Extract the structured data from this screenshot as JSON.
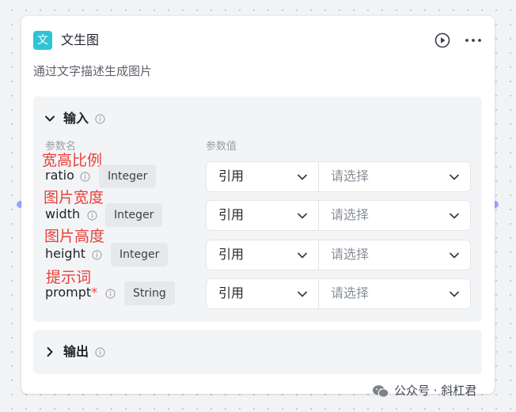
{
  "node": {
    "icon_text": "文",
    "title": "文生图",
    "description": "通过文字描述生成图片",
    "accent_color": "#2ec4d6",
    "run_icon": "play-circle-icon",
    "more_icon": "more-horizontal-icon"
  },
  "inputs": {
    "title": "输入",
    "col_name": "参数名",
    "col_value": "参数值",
    "params": [
      {
        "annotation": "宽高比例",
        "name": "ratio",
        "required": "",
        "type": "Integer",
        "source": "引用",
        "value_placeholder": "请选择"
      },
      {
        "annotation": "图片宽度",
        "name": "width",
        "required": "",
        "type": "Integer",
        "source": "引用",
        "value_placeholder": "请选择"
      },
      {
        "annotation": "图片高度",
        "name": "height",
        "required": "",
        "type": "Integer",
        "source": "引用",
        "value_placeholder": "请选择"
      },
      {
        "annotation": "提示词",
        "name": "prompt",
        "required": "*",
        "type": "String",
        "source": "引用",
        "value_placeholder": "请选择"
      }
    ]
  },
  "outputs": {
    "title": "输出"
  },
  "watermark": {
    "text": "公众号 · 斜杠君",
    "icon": "wechat-icon"
  }
}
